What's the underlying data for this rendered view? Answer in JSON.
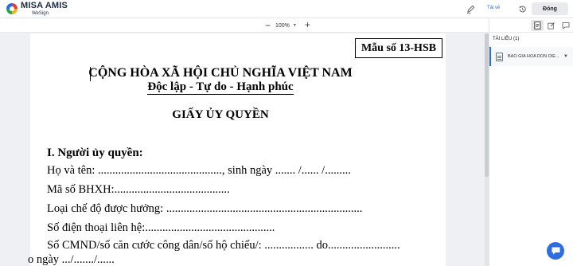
{
  "app": {
    "brand": "MISA AMIS",
    "sub": "WeSign"
  },
  "toolbar": {
    "download_label": "Tải về",
    "close_label": "Đóng"
  },
  "zoom": {
    "level": "100%"
  },
  "document": {
    "form_no": "Mẫu số 13-HSB",
    "nation": "CỘNG HÒA XÃ HỘI CHỦ NGHĨA VIỆT NAM",
    "motto": "Độc lập - Tự do - Hạnh phúc",
    "title": "GIẤY ỦY QUYỀN",
    "section": "I. Người ủy quyền:",
    "lines": [
      "Họ và tên: ..........................................., sinh ngày ....... /...... /.........",
      "Mã số BHXH:........................................",
      "Loại chế độ được hưởng: ....................................................................",
      "Số điện thoại liên hệ:.............................................",
      "Số CMND/số căn cước công dân/số hộ chiếu/: ................. do.........................",
      "o ngày .../......./......"
    ]
  },
  "sidebar": {
    "title": "TÀI LIỆU (1)",
    "documents": [
      {
        "name": "BAO GIA HOA DON DIE..."
      }
    ]
  },
  "icons": {
    "sign": "pen-sign-icon",
    "history": "history-icon",
    "doc_tab": "document-tab-icon",
    "edit_tab": "edit-tab-icon",
    "comment_tab": "comment-tab-icon",
    "chat": "chat-support-icon"
  },
  "colors": {
    "accent": "#2e6de0"
  }
}
